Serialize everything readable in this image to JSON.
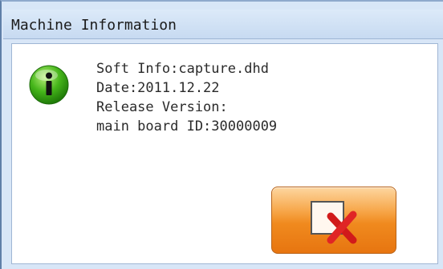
{
  "window": {
    "title": "Machine Information"
  },
  "message": {
    "icon": "info-icon",
    "lines": [
      "Soft Info:capture.dhd",
      "Date:2011.12.22",
      "Release Version:",
      "main board ID:30000009"
    ]
  },
  "close_button": {
    "icon": "close-x-icon",
    "accent": "#f08a1e"
  }
}
